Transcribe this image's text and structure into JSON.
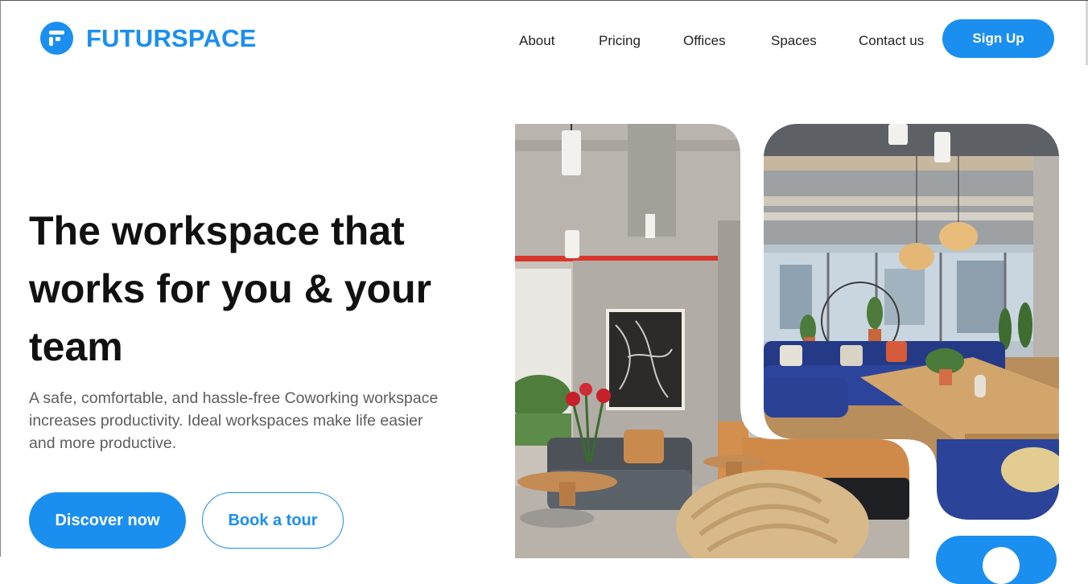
{
  "brand": {
    "name": "FUTURSPACE",
    "color": "#1a8ff0",
    "logo_icon": "futurspace-logo-icon"
  },
  "nav": {
    "items": [
      {
        "label": "About"
      },
      {
        "label": "Pricing"
      },
      {
        "label": "Offices"
      },
      {
        "label": "Spaces"
      },
      {
        "label": "Contact us"
      }
    ],
    "cta_label": "Sign Up"
  },
  "hero": {
    "headline": "The workspace that works for you & your team",
    "subtitle": "A safe, comfortable, and hassle-free Coworking workspace increases productivity. Ideal workspaces make life easier and more productive.",
    "primary_button": "Discover now",
    "secondary_button": "Book a tour"
  }
}
